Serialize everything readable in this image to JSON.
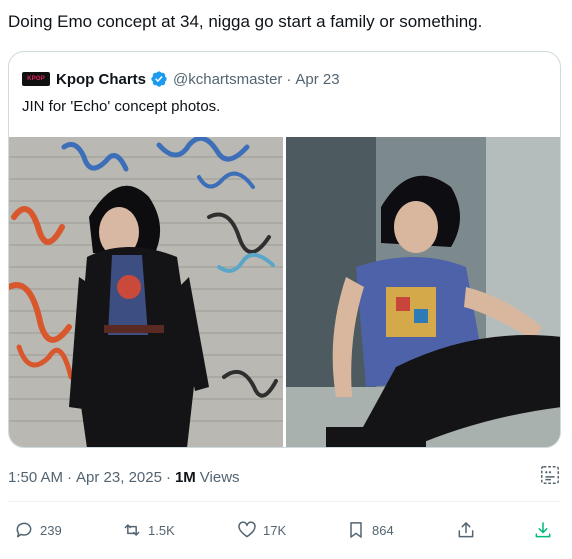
{
  "tweet": {
    "text": "Doing Emo concept at 34, nigga go start a family or something."
  },
  "quote": {
    "logo_text": "KPOP",
    "name": "Kpop Charts",
    "handle": "@kchartsmaster",
    "separator": "·",
    "date": "Apr 23",
    "text": "JIN for 'Echo' concept photos.",
    "images": [
      "photo-graffiti-wall",
      "photo-sitting-blue-tshirt"
    ]
  },
  "meta": {
    "time": "1:50 AM",
    "separator": "·",
    "date": "Apr 23, 2025",
    "views_count": "1M",
    "views_label": "Views"
  },
  "actions": {
    "replies": "239",
    "reposts": "1.5K",
    "likes": "17K",
    "bookmarks": "864"
  },
  "colors": {
    "text_primary": "#0f1419",
    "text_secondary": "#536471",
    "border": "#cfd9de",
    "verified_blue": "#1d9bf0",
    "download_green": "#00ba7c"
  },
  "icons": [
    "verified-badge-icon",
    "grok-icon",
    "reply-icon",
    "repost-icon",
    "like-icon",
    "bookmark-icon",
    "share-icon",
    "download-icon"
  ]
}
